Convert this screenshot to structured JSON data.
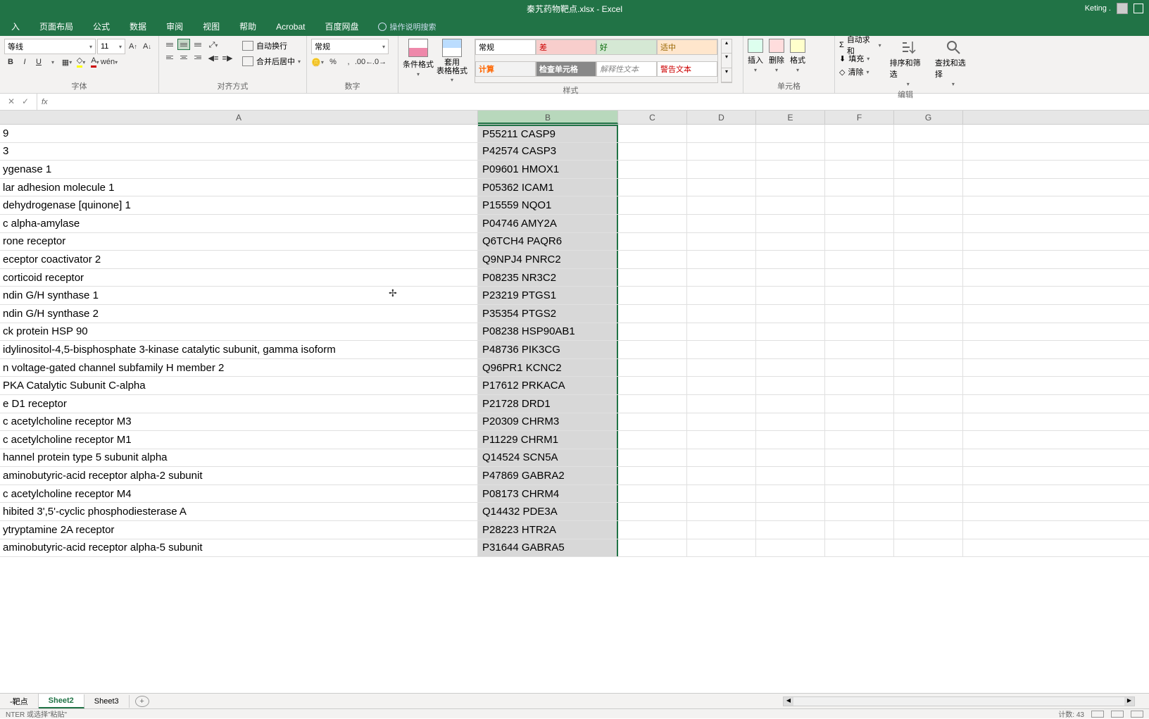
{
  "title": "秦艽药物靶点.xlsx  -  Excel",
  "user_name": "Keting .",
  "tabs": {
    "insert": "入",
    "layout": "页面布局",
    "formula": "公式",
    "data": "数据",
    "review": "审阅",
    "view": "视图",
    "help": "帮助",
    "acrobat": "Acrobat",
    "baidu": "百度网盘",
    "tellme": "操作说明搜索"
  },
  "font": {
    "name": "等线",
    "size": "11",
    "group_label": "字体"
  },
  "align": {
    "wrap": "自动换行",
    "merge": "合并后居中",
    "group_label": "对齐方式"
  },
  "number": {
    "format": "常规",
    "group_label": "数字"
  },
  "styles": {
    "cond": "条件格式",
    "table": "套用\n表格格式",
    "s1": "常规",
    "s2": "差",
    "s3": "好",
    "s4": "适中",
    "s5": "计算",
    "s6": "检查单元格",
    "s7": "解释性文本",
    "s8": "警告文本",
    "group_label": "样式"
  },
  "cells": {
    "insert": "插入",
    "delete": "删除",
    "format": "格式",
    "group_label": "单元格"
  },
  "editing": {
    "sum": "自动求和",
    "fill": "填充",
    "clear": "清除",
    "sort": "排序和筛选",
    "find": "查找和选择",
    "group_label": "编辑"
  },
  "columns": [
    "A",
    "B",
    "C",
    "D",
    "E",
    "F",
    "G"
  ],
  "rows": [
    {
      "a": "9",
      "b": "P55211 CASP9"
    },
    {
      "a": "3",
      "b": "P42574 CASP3"
    },
    {
      "a": "ygenase 1",
      "b": "P09601 HMOX1"
    },
    {
      "a": "lar adhesion molecule 1",
      "b": "P05362 ICAM1"
    },
    {
      "a": " dehydrogenase [quinone] 1",
      "b": "P15559 NQO1"
    },
    {
      "a": "c alpha-amylase",
      "b": "P04746 AMY2A"
    },
    {
      "a": "rone receptor",
      "b": "Q6TCH4 PAQR6"
    },
    {
      "a": "eceptor coactivator 2",
      "b": "Q9NPJ4 PNRC2"
    },
    {
      "a": "corticoid receptor",
      "b": "P08235 NR3C2"
    },
    {
      "a": "ndin G/H synthase 1",
      "b": "P23219 PTGS1"
    },
    {
      "a": "ndin G/H synthase 2",
      "b": "P35354 PTGS2"
    },
    {
      "a": "ck protein HSP 90",
      "b": "P08238 HSP90AB1"
    },
    {
      "a": "idylinositol-4,5-bisphosphate 3-kinase catalytic subunit, gamma isoform",
      "b": "P48736 PIK3CG"
    },
    {
      "a": "n voltage-gated channel subfamily H member 2",
      "b": "Q96PR1 KCNC2"
    },
    {
      "a": " PKA Catalytic Subunit C-alpha",
      "b": "P17612 PRKACA"
    },
    {
      "a": "e D1 receptor",
      "b": "P21728 DRD1"
    },
    {
      "a": "c acetylcholine receptor M3",
      "b": "P20309 CHRM3"
    },
    {
      "a": "c acetylcholine receptor M1",
      "b": "P11229 CHRM1"
    },
    {
      "a": "hannel protein type 5 subunit alpha",
      "b": "Q14524 SCN5A"
    },
    {
      "a": "aminobutyric-acid receptor alpha-2 subunit",
      "b": "P47869 GABRA2"
    },
    {
      "a": "c acetylcholine receptor M4",
      "b": "P08173 CHRM4"
    },
    {
      "a": "hibited 3',5'-cyclic phosphodiesterase A",
      "b": "Q14432 PDE3A"
    },
    {
      "a": "ytryptamine 2A receptor",
      "b": "P28223 HTR2A"
    },
    {
      "a": "aminobutyric-acid receptor alpha-5 subunit",
      "b": "P31644 GABRA5"
    }
  ],
  "sheets": {
    "s1": "-靶点",
    "s2": "Sheet2",
    "s3": "Sheet3"
  },
  "status": {
    "mode": "NTER 或选择\"粘贴\"",
    "count": "计数: 43"
  }
}
